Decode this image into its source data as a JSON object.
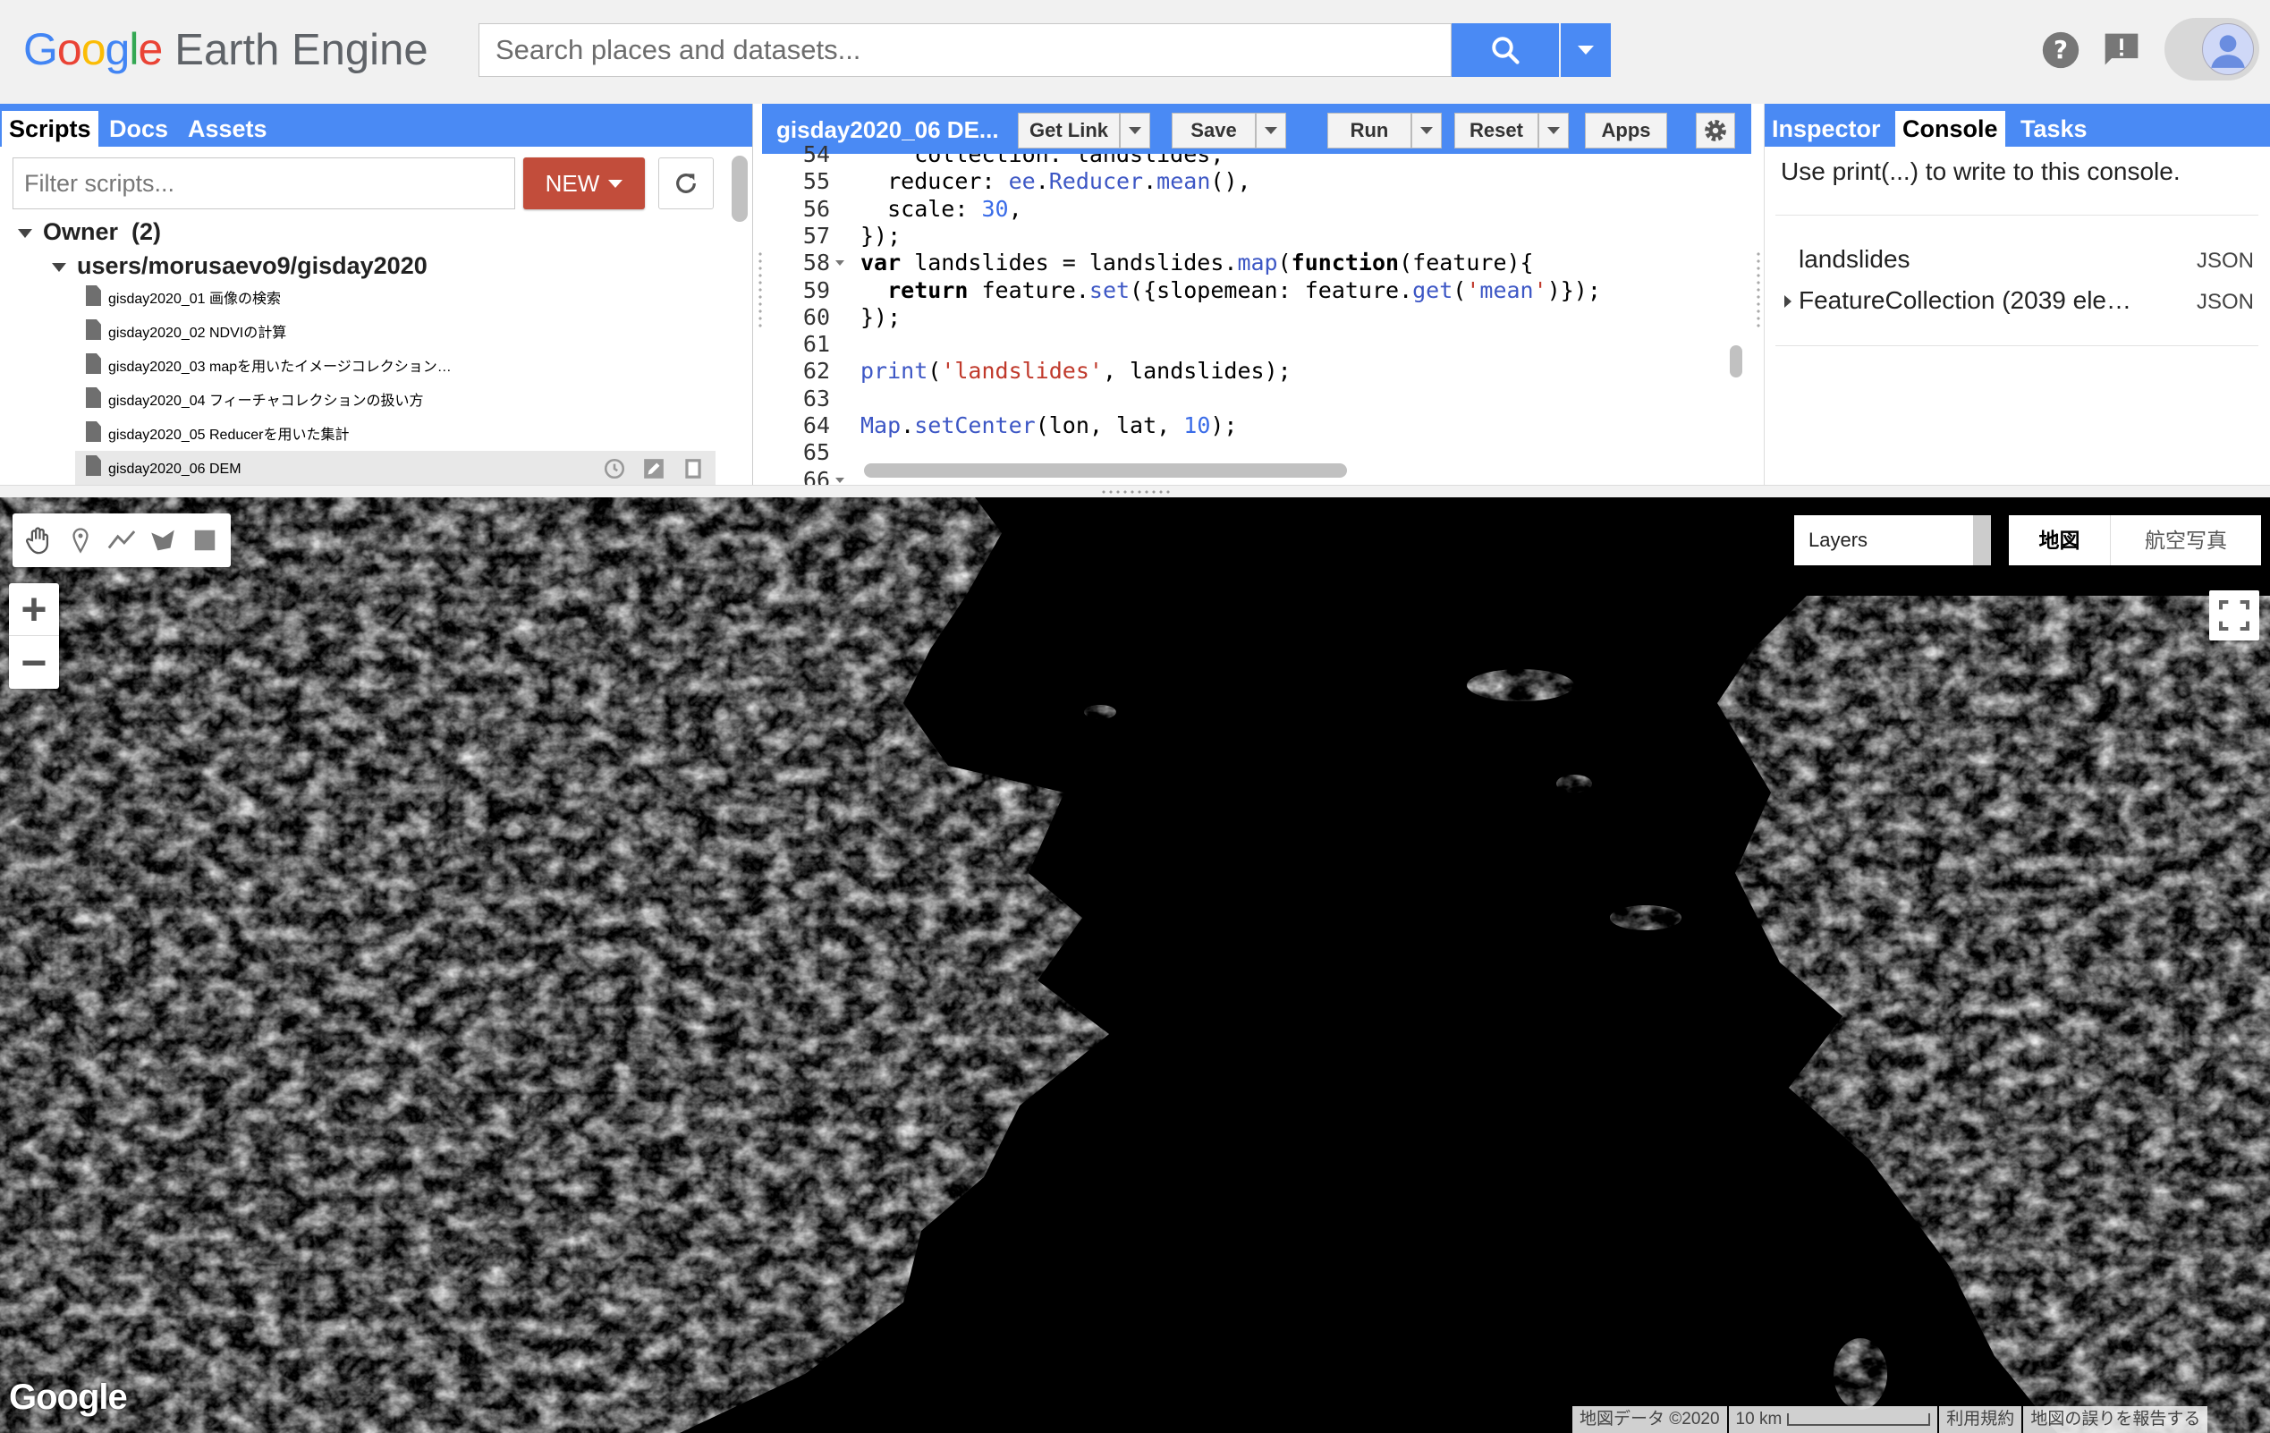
{
  "header": {
    "logo_google": "Google",
    "logo_product": "Earth Engine",
    "search_placeholder": "Search places and datasets..."
  },
  "scripts_panel": {
    "tabs": [
      {
        "label": "Scripts",
        "active": true
      },
      {
        "label": "Docs",
        "active": false
      },
      {
        "label": "Assets",
        "active": false
      }
    ],
    "filter_placeholder": "Filter scripts...",
    "new_button": "NEW",
    "tree": {
      "owner_label": "Owner",
      "owner_count": "(2)",
      "repo": "users/morusaevo9/gisday2020",
      "files": [
        "gisday2020_01 画像の検索",
        "gisday2020_02 NDVIの計算",
        "gisday2020_03 mapを用いたイメージコレクション…",
        "gisday2020_04 フィーチャコレクションの扱い方",
        "gisday2020_05 Reducerを用いた集計",
        "gisday2020_06 DEM"
      ]
    }
  },
  "editor": {
    "file_title": "gisday2020_06 DE...",
    "buttons": {
      "get_link": "Get Link",
      "save": "Save",
      "run": "Run",
      "reset": "Reset",
      "apps": "Apps"
    },
    "lines": [
      {
        "n": "54",
        "code": "    collection: landslides,"
      },
      {
        "n": "55",
        "code": "  reducer: ee.Reducer.mean(),"
      },
      {
        "n": "56",
        "code": "  scale: 30,"
      },
      {
        "n": "57",
        "code": "});"
      },
      {
        "n": "58",
        "code": "var landslides = landslides.map(function(feature){"
      },
      {
        "n": "59",
        "code": "  return feature.set({slopemean: feature.get('mean')});"
      },
      {
        "n": "60",
        "code": "});"
      },
      {
        "n": "61",
        "code": ""
      },
      {
        "n": "62",
        "code": "print('landslides', landslides);"
      },
      {
        "n": "63",
        "code": ""
      },
      {
        "n": "64",
        "code": "Map.setCenter(lon, lat, 10);"
      },
      {
        "n": "65",
        "code": ""
      },
      {
        "n": "66",
        "code": ""
      }
    ]
  },
  "console_panel": {
    "tabs": [
      {
        "label": "Inspector",
        "active": false
      },
      {
        "label": "Console",
        "active": true
      },
      {
        "label": "Tasks",
        "active": false
      }
    ],
    "hint": "Use print(...) to write to this console.",
    "entries": [
      {
        "text": "landslides",
        "badge": "JSON"
      },
      {
        "text": "FeatureCollection (2039 ele…",
        "badge": "JSON"
      }
    ]
  },
  "map": {
    "layers_label": "Layers",
    "map_type_map": "地図",
    "map_type_satellite": "航空写真",
    "zoom_in": "+",
    "zoom_out": "−",
    "watermark": "Google",
    "attribution": {
      "data": "地図データ ©2020",
      "scale": "10 km",
      "terms": "利用規約",
      "report": "地図の誤りを報告する"
    }
  },
  "colors": {
    "accent_blue": "#4a8af4",
    "new_button_red": "#c24d3b",
    "map_background": "#000000"
  }
}
